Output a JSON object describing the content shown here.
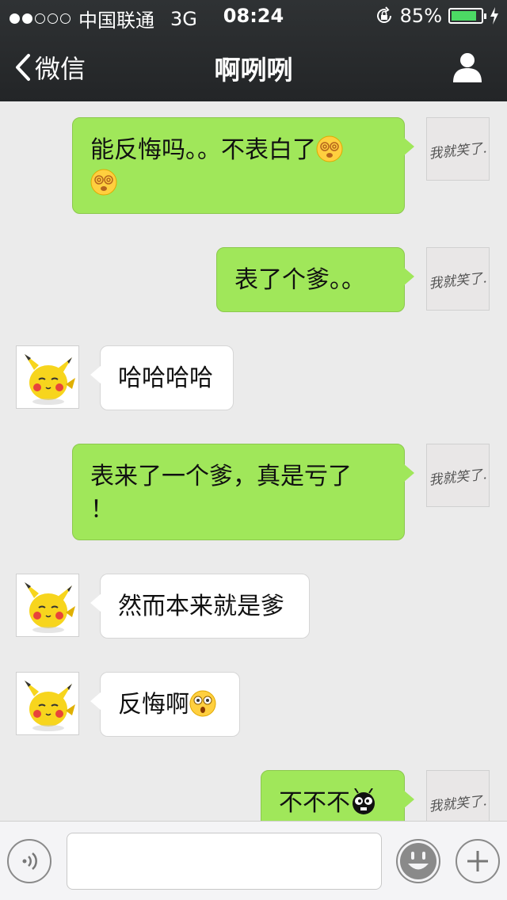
{
  "status_bar": {
    "carrier": "中国联通",
    "network": "3G",
    "time": "08:24",
    "battery": "85%",
    "battery_level": 0.85
  },
  "nav": {
    "back_label": "微信",
    "title": "啊咧咧"
  },
  "avatars": {
    "self_text": "我就笑了.",
    "other_icon": "pikachu-avatar"
  },
  "messages": [
    {
      "side": "sent",
      "text": "能反悔吗。。不表白了",
      "emojis": [
        "dizzy-face-emoji",
        "dizzy-face-emoji"
      ]
    },
    {
      "side": "sent",
      "text": "表了个爹。。"
    },
    {
      "side": "received",
      "text": "哈哈哈哈"
    },
    {
      "side": "sent",
      "text": "表来了一个爹，真是亏了",
      "text_line2": "！"
    },
    {
      "side": "received",
      "text": "然而本来就是爹"
    },
    {
      "side": "received",
      "text": "反悔啊",
      "emojis": [
        "flushed-face-emoji"
      ]
    },
    {
      "side": "sent",
      "text": "不不不",
      "emojis": [
        "black-creature-emoji"
      ]
    }
  ],
  "input": {
    "value": "",
    "placeholder": ""
  },
  "colors": {
    "header": "#2a2c2e",
    "chat_bg": "#ebebeb",
    "sent_bubble": "#a0e75a",
    "received_bubble": "#ffffff",
    "battery_fill": "#4cd964"
  }
}
